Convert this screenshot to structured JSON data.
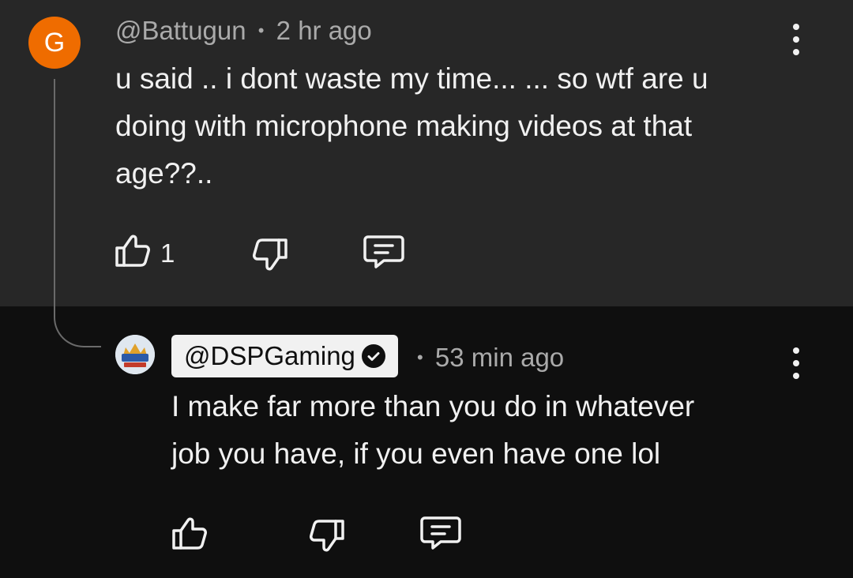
{
  "comment": {
    "avatar_letter": "G",
    "author": "@Battugun",
    "separator": "•",
    "time": "2 hr ago",
    "text_line1": "u said .. i dont waste my time... ... so wtf are u",
    "text_line2": "doing with microphone making videos at that",
    "text_line3": "age??..",
    "like_count": "1"
  },
  "reply": {
    "author": "@DSPGaming",
    "separator": "•",
    "time": "53 min ago",
    "text_line1": "I make far more than you do in whatever",
    "text_line2": "job you have, if you even have one lol"
  },
  "colors": {
    "comment_bg": "#272727",
    "reply_bg": "#0f0f0f",
    "avatar_orange": "#ef6c00",
    "meta_gray": "#aaaaaa",
    "text_white": "#f1f1f1"
  },
  "icons": [
    "thumbs-up-icon",
    "thumbs-down-icon",
    "reply-icon",
    "more-vertical-icon",
    "verified-check-icon"
  ]
}
